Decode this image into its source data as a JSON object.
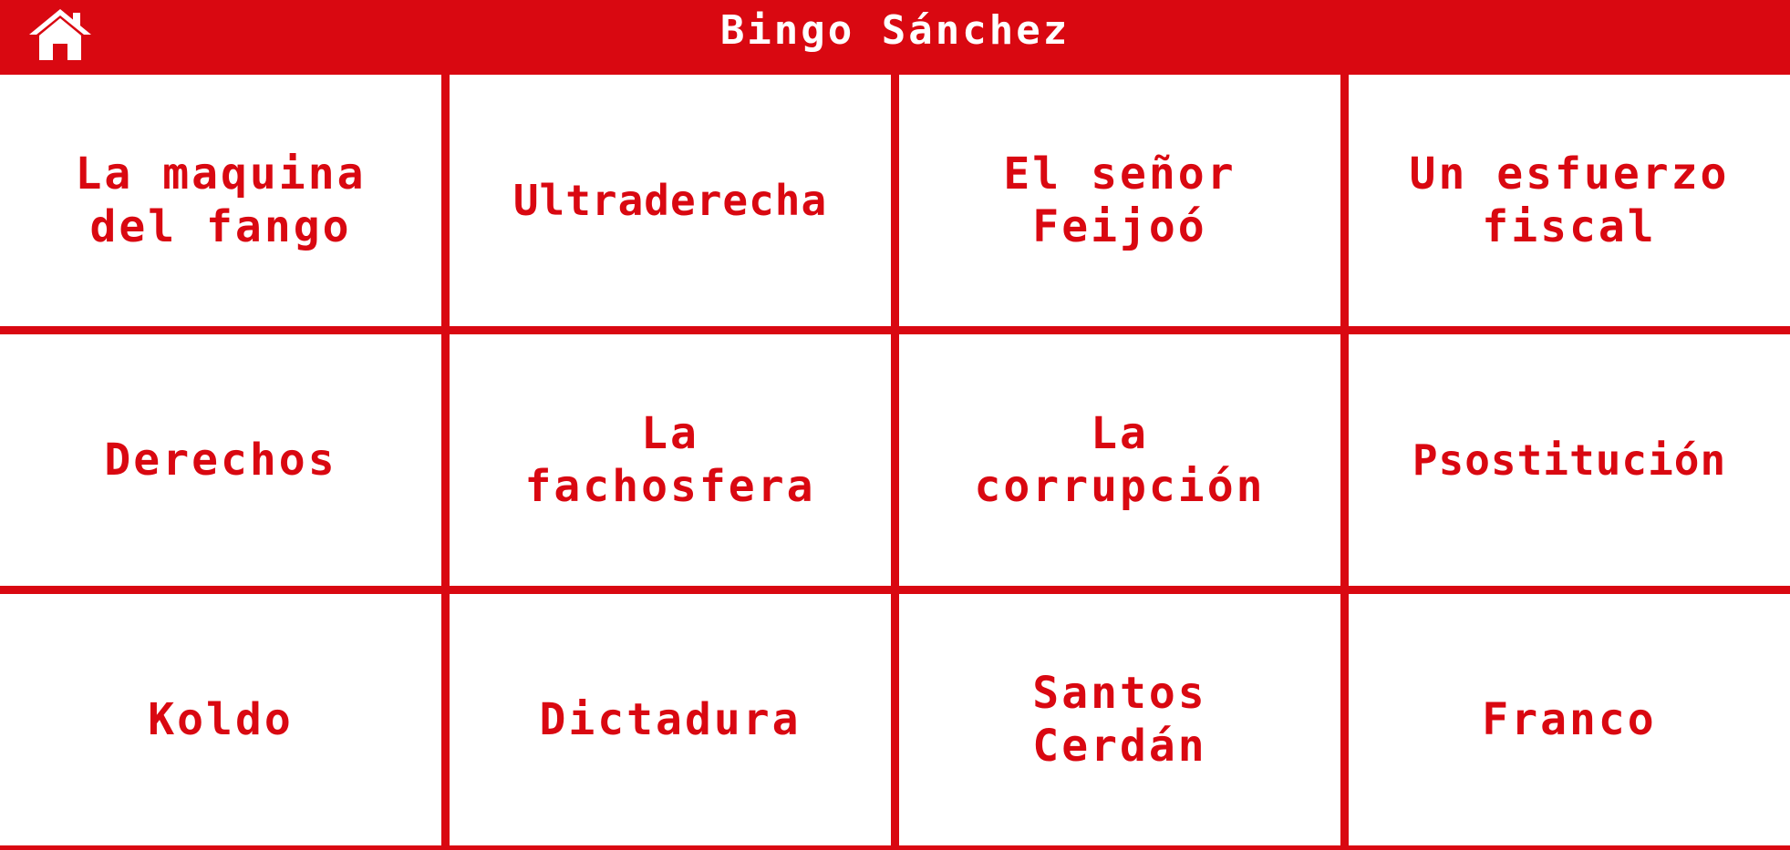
{
  "header": {
    "title": "Bingo Sánchez",
    "home_icon": "home-icon"
  },
  "colors": {
    "primary": "#d90811",
    "cell_background": "#ffffff",
    "text_on_primary": "#ffffff"
  },
  "cells": [
    {
      "label": "La maquina\ndel fango"
    },
    {
      "label": "Ultraderecha"
    },
    {
      "label": "El señor\nFeijoó"
    },
    {
      "label": "Un esfuerzo\nfiscal"
    },
    {
      "label": "Derechos"
    },
    {
      "label": "La\nfachosfera"
    },
    {
      "label": "La\ncorrupción"
    },
    {
      "label": "Psostitución"
    },
    {
      "label": "Koldo"
    },
    {
      "label": "Dictadura"
    },
    {
      "label": "Santos\nCerdán"
    },
    {
      "label": "Franco"
    }
  ]
}
